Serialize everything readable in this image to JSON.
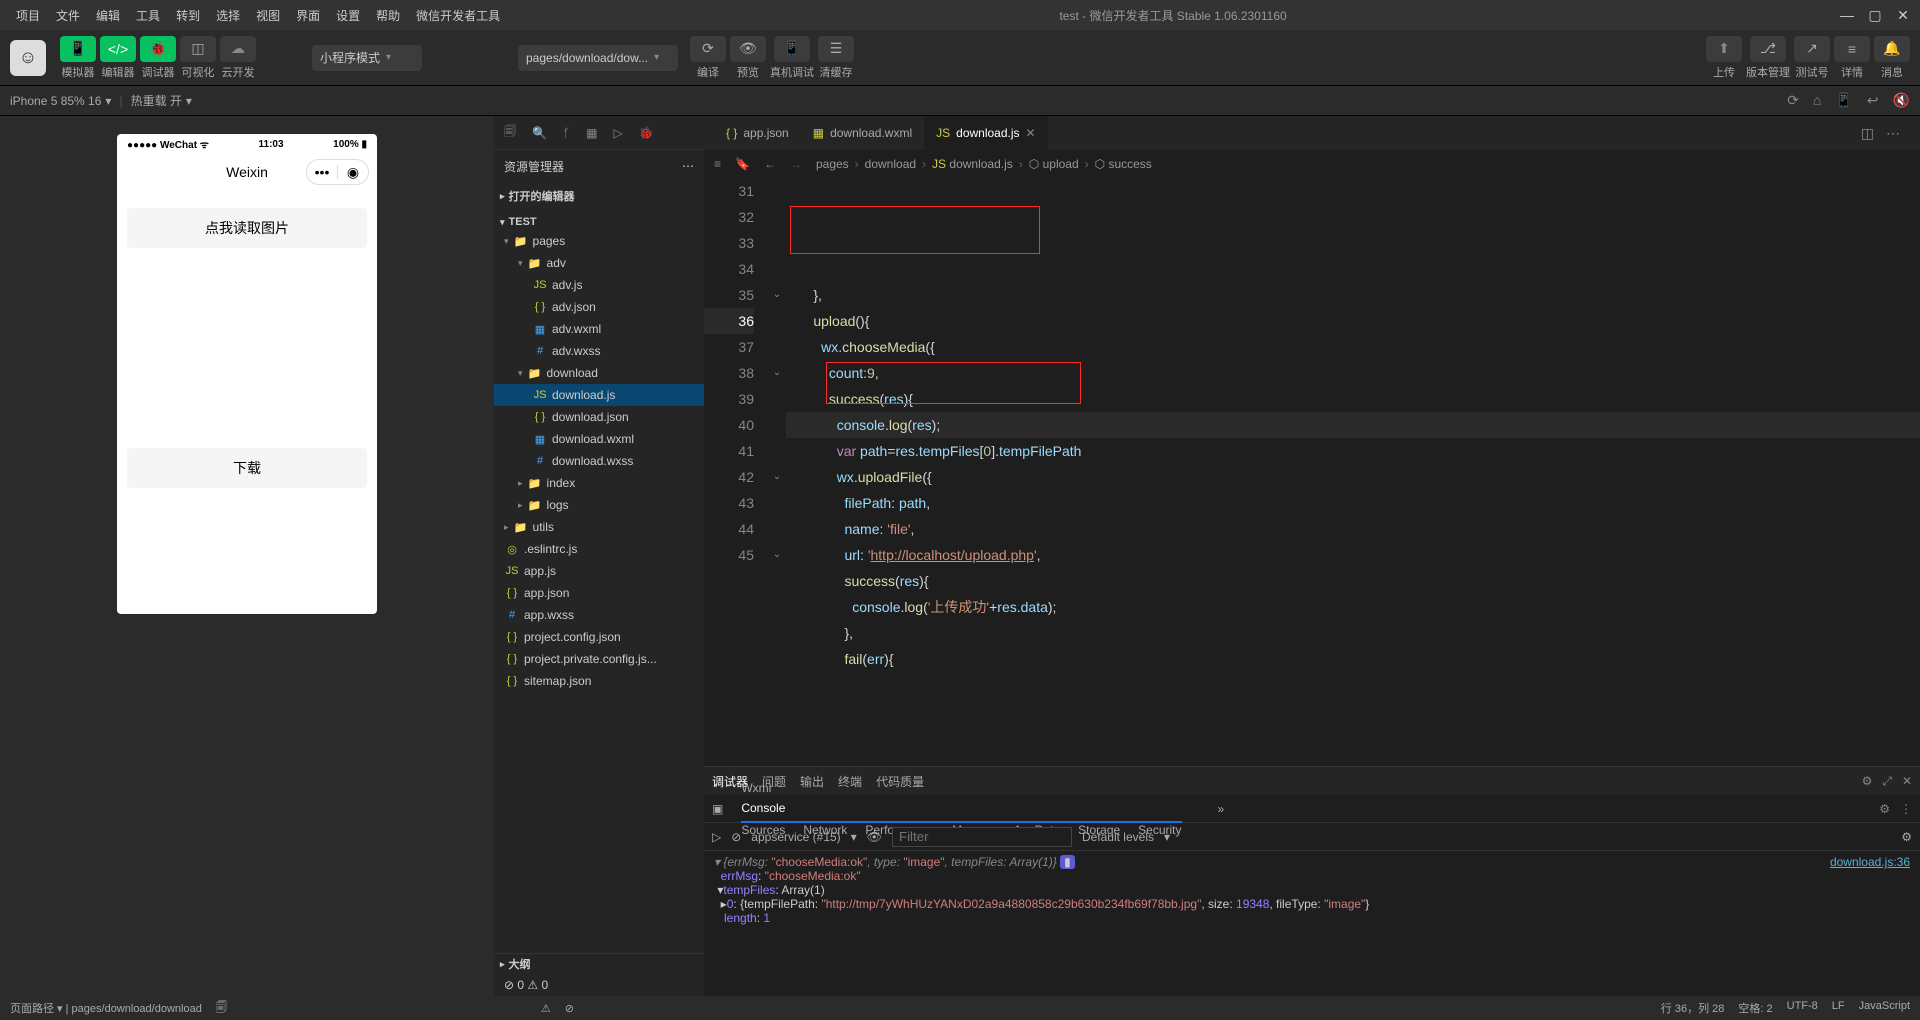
{
  "menu": [
    "项目",
    "文件",
    "编辑",
    "工具",
    "转到",
    "选择",
    "视图",
    "界面",
    "设置",
    "帮助",
    "微信开发者工具"
  ],
  "window_title": "test - 微信开发者工具 Stable 1.06.2301160",
  "toolbar": {
    "left_labels": [
      "模拟器",
      "编辑器",
      "调试器",
      "可视化",
      "云开发"
    ],
    "mode_dropdown": "小程序模式",
    "page_dropdown": "pages/download/dow...",
    "center_labels": [
      "编译",
      "预览",
      "真机调试",
      "清缓存"
    ],
    "right_labels": [
      "上传",
      "版本管理",
      "测试号",
      "详情",
      "消息"
    ]
  },
  "sim_bar": {
    "device": "iPhone 5 85% 16",
    "hot_reload": "热重载 开"
  },
  "phone": {
    "carrier": "●●●●● WeChat",
    "signal_wifi": "⌃",
    "time": "11:03",
    "battery": "100%",
    "title": "Weixin",
    "btn1": "点我读取图片",
    "btn2": "下载"
  },
  "explorer": {
    "title": "资源管理器",
    "sections": {
      "open_editors": "打开的编辑器",
      "project": "TEST",
      "outline": "大纲"
    },
    "tree": {
      "pages": "pages",
      "adv": "adv",
      "adv_files": [
        "adv.js",
        "adv.json",
        "adv.wxml",
        "adv.wxss"
      ],
      "download": "download",
      "download_files": [
        "download.js",
        "download.json",
        "download.wxml",
        "download.wxss"
      ],
      "index": "index",
      "logs": "logs",
      "utils": "utils",
      "root_files": [
        ".eslintrc.js",
        "app.js",
        "app.json",
        "app.wxss",
        "project.config.json",
        "project.private.config.js...",
        "sitemap.json"
      ]
    },
    "problems": "⊘ 0 ⚠ 0"
  },
  "tabs": [
    {
      "icon": "{ }",
      "label": "app.json",
      "active": false
    },
    {
      "icon": "▦",
      "label": "download.wxml",
      "active": false
    },
    {
      "icon": "JS",
      "label": "download.js",
      "active": true
    }
  ],
  "breadcrumb": [
    "pages",
    "download",
    "download.js",
    "upload",
    "success"
  ],
  "code_lines": [
    {
      "n": 31,
      "html": "      <span class='tok-punc'>},</span>"
    },
    {
      "n": 32,
      "html": "      <span class='tok-fn'>upload</span><span class='tok-punc'>(){</span>"
    },
    {
      "n": 33,
      "html": "        <span class='tok-obj'>wx</span><span class='tok-punc'>.</span><span class='tok-fn'>chooseMedia</span><span class='tok-punc'>({</span>"
    },
    {
      "n": 34,
      "html": "          <span class='tok-obj'>count</span><span class='tok-punc'>:</span><span class='tok-num'>9</span><span class='tok-punc'>,</span>"
    },
    {
      "n": 35,
      "html": "          <span class='tok-fn'>success</span><span class='tok-punc'>(</span><span class='tok-param'>res</span><span class='tok-punc'>){</span>"
    },
    {
      "n": 36,
      "html": "            <span class='tok-obj'>console</span><span class='tok-punc'>.</span><span class='tok-fn'>log</span><span class='tok-punc'>(</span><span class='tok-param'>res</span><span class='tok-punc'>);</span>",
      "current": true
    },
    {
      "n": 37,
      "html": "            <span class='tok-key'>var</span> <span class='tok-obj'>path</span><span class='tok-punc'>=</span><span class='tok-obj'>res</span><span class='tok-punc'>.</span><span class='tok-obj'>tempFiles</span><span class='tok-punc'>[</span><span class='tok-num'>0</span><span class='tok-punc'>].</span><span class='tok-obj'>tempFilePath</span>"
    },
    {
      "n": 38,
      "html": "            <span class='tok-obj'>wx</span><span class='tok-punc'>.</span><span class='tok-fn'>uploadFile</span><span class='tok-punc'>({</span>"
    },
    {
      "n": 39,
      "html": "              <span class='tok-obj'>filePath</span><span class='tok-punc'>:</span> <span class='tok-obj'>path</span><span class='tok-punc'>,</span>"
    },
    {
      "n": 40,
      "html": "              <span class='tok-obj'>name</span><span class='tok-punc'>:</span> <span class='tok-str'>'file'</span><span class='tok-punc'>,</span>"
    },
    {
      "n": 41,
      "html": "              <span class='tok-obj'>url</span><span class='tok-punc'>:</span> <span class='tok-str'>'<span class='tok-url'>http://localhost/upload.php</span>'</span><span class='tok-punc'>,</span>"
    },
    {
      "n": 42,
      "html": "              <span class='tok-fn'>success</span><span class='tok-punc'>(</span><span class='tok-param'>res</span><span class='tok-punc'>){</span>"
    },
    {
      "n": 43,
      "html": "                <span class='tok-obj'>console</span><span class='tok-punc'>.</span><span class='tok-fn'>log</span><span class='tok-punc'>(</span><span class='tok-str'>'上传成功'</span><span class='tok-punc'>+</span><span class='tok-obj'>res</span><span class='tok-punc'>.</span><span class='tok-obj'>data</span><span class='tok-punc'>);</span>"
    },
    {
      "n": 44,
      "html": "              <span class='tok-punc'>},</span>"
    },
    {
      "n": 45,
      "html": "              <span class='tok-fn'>fail</span><span class='tok-punc'>(</span><span class='tok-param'>err</span><span class='tok-punc'>){</span>"
    }
  ],
  "folds": {
    "35": "⌄",
    "38": "⌄",
    "42": "⌄",
    "45": "⌄"
  },
  "panel": {
    "tabs1": [
      "调试器",
      "问题",
      "输出",
      "终端",
      "代码质量"
    ],
    "tabs2": [
      "Wxml",
      "Console",
      "Sources",
      "Network",
      "Performance",
      "Memory",
      "AppData",
      "Storage",
      "Security"
    ],
    "context": "appservice (#15)",
    "filter_placeholder": "Filter",
    "levels": "Default levels",
    "source_link": "download.js:36",
    "console": {
      "l1_pre": "▾ {errMsg: ",
      "l1_s1": "\"chooseMedia:ok\"",
      "l1_m": ", type: ",
      "l1_s2": "\"image\"",
      "l1_m2": ", tempFiles: Array(1)}",
      "l2_k": "errMsg",
      "l2_v": "\"chooseMedia:ok\"",
      "l3_k": "tempFiles",
      "l3_v": "Array(1)",
      "l4_k": "0",
      "l4_p": "{tempFilePath: ",
      "l4_s": "\"http://tmp/7yWhHUzYANxD02a9a4880858c29b630b234fb69f78bb.jpg\"",
      "l4_m": ", size: ",
      "l4_n": "19348",
      "l4_m2": ", fileType: ",
      "l4_s2": "\"image\"",
      "l4_e": "}",
      "l5_k": "length",
      "l5_v": "1"
    }
  },
  "statusbar": {
    "left": "页面路径 ▾ | pages/download/download",
    "pos": "行 36，列 28",
    "indent": "空格: 2",
    "enc": "UTF-8",
    "eol": "LF",
    "lang": "JavaScript"
  }
}
